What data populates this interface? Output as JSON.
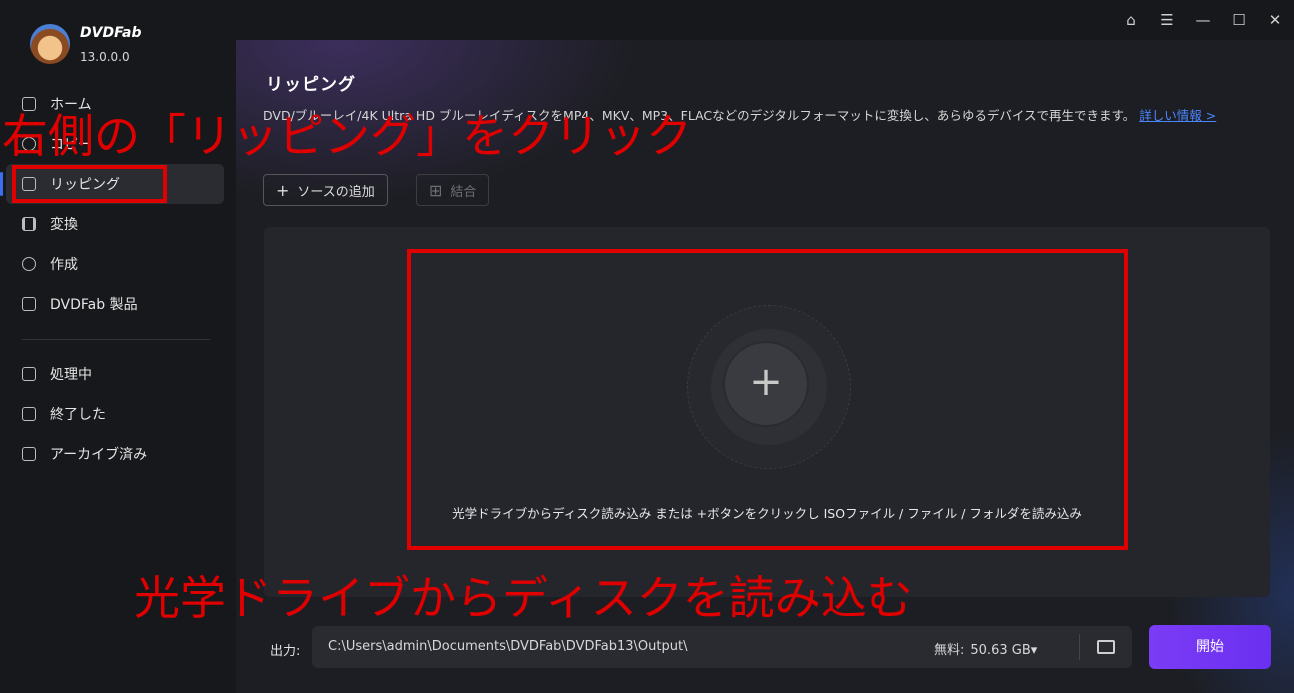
{
  "app": {
    "brand": "DVDFab",
    "version": "13.0.0.0"
  },
  "sidebar": {
    "items": [
      {
        "label": "ホーム"
      },
      {
        "label": "コピー"
      },
      {
        "label": "リッピング"
      },
      {
        "label": "変換"
      },
      {
        "label": "作成"
      },
      {
        "label": "DVDFab 製品"
      }
    ],
    "tasks": [
      {
        "label": "処理中"
      },
      {
        "label": "終了した"
      },
      {
        "label": "アーカイブ済み"
      }
    ]
  },
  "main": {
    "title": "リッピング",
    "description": "DVD/ブルーレイ/4K Ultra HD ブルーレイディスクをMP4、MKV、MP3、FLACなどのデジタルフォーマットに変換し、あらゆるデバイスで再生できます。",
    "more_link": "詳しい情報 >",
    "add_source": "ソースの追加",
    "merge": "結合",
    "drop_hint": "光学ドライブからディスク読み込み または +ボタンをクリックし ISOファイル / ファイル / フォルダを読み込み"
  },
  "output": {
    "label": "出力:",
    "path": "C:\\Users\\admin\\Documents\\DVDFab\\DVDFab13\\Output\\",
    "free_label": "無料:",
    "free_value": "50.63 GB▾",
    "start": "開始"
  },
  "annotations": {
    "top": "右側の「リッピング」をクリック",
    "bottom": "光学ドライブからディスクを読み込む"
  },
  "colors": {
    "accent": "#3d6df2",
    "start_button": "#7b3cf5",
    "annotation": "#e00000"
  }
}
